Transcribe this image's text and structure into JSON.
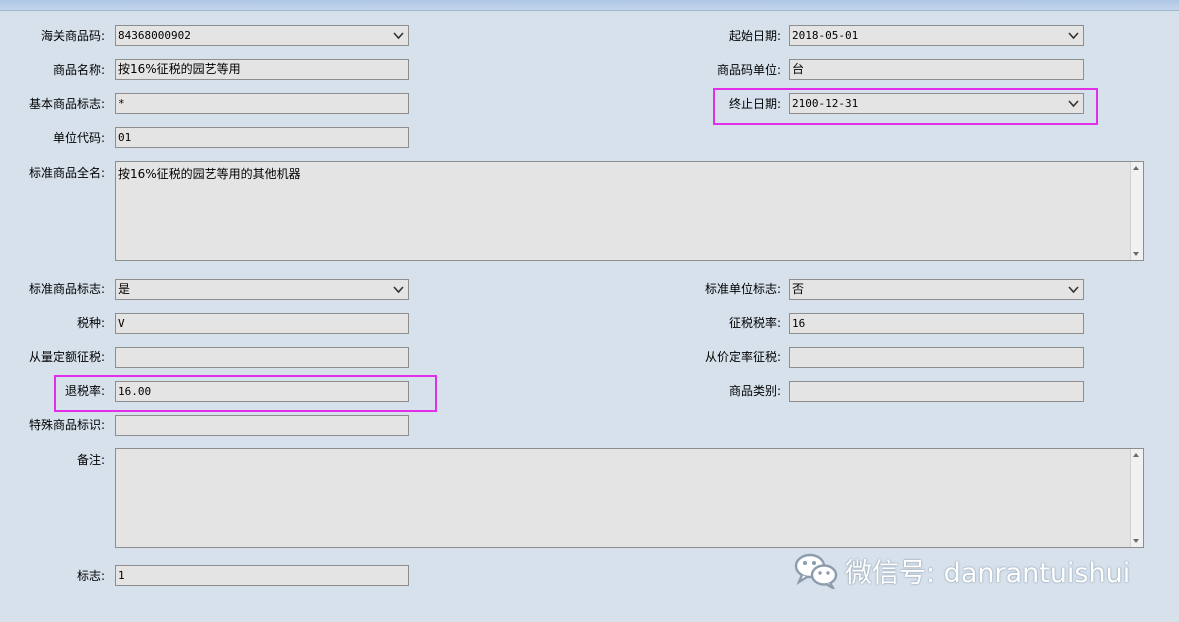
{
  "labels": {
    "customs_code": "海关商品码:",
    "product_name": "商品名称:",
    "basic_flag": "基本商品标志:",
    "unit_code": "单位代码:",
    "std_full_name": "标准商品全名:",
    "std_product_flag": "标准商品标志:",
    "tax_type": "税种:",
    "quantity_tax": "从量定额征税:",
    "refund_rate": "退税率:",
    "special_id": "特殊商品标识:",
    "remarks": "备注:",
    "flag": "标志:",
    "start_date": "起始日期:",
    "code_unit": "商品码单位:",
    "end_date": "终止日期:",
    "std_unit_flag": "标准单位标志:",
    "tax_rate": "征税税率:",
    "value_tax": "从价定率征税:",
    "category": "商品类别:"
  },
  "values": {
    "customs_code": "84368000902",
    "product_name": "按16%征税的园艺等用",
    "basic_flag": "*",
    "unit_code": "01",
    "std_full_name": "按16%征税的园艺等用的其他机器",
    "std_product_flag": "是",
    "tax_type": "V",
    "quantity_tax": "",
    "refund_rate": "16.00",
    "special_id": "",
    "remarks": "",
    "flag": "1",
    "start_date": "2018-05-01",
    "code_unit": "台",
    "end_date": "2100-12-31",
    "std_unit_flag": "否",
    "tax_rate": "16",
    "value_tax": "",
    "category": ""
  },
  "watermark": {
    "text": "微信号: danrantuishui",
    "icon": "wechat-icon"
  },
  "colors": {
    "highlight": "#e22ee8",
    "background": "#d6e1ec",
    "field": "#e4e4e4"
  }
}
